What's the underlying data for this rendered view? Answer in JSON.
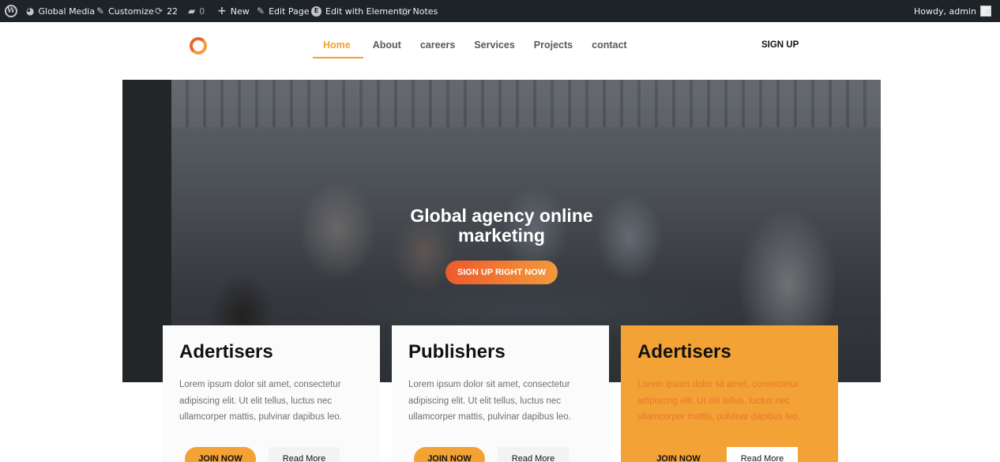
{
  "admin_bar": {
    "site_name": "Global Media",
    "customize": "Customize",
    "updates_count": "22",
    "comments_count": "0",
    "new": "New",
    "edit_page": "Edit Page",
    "elementor": "Edit with Elementor",
    "notes": "Notes",
    "greeting": "Howdy, admin"
  },
  "nav": {
    "items": [
      "Home",
      "About",
      "careers",
      "Services",
      "Projects",
      "contact"
    ],
    "active": "Home",
    "signup": "SIGN UP"
  },
  "hero": {
    "title": "Global agency online marketing",
    "button": "SIGN UP RIGHT NOW"
  },
  "cards": [
    {
      "title": "Adertisers",
      "text": "Lorem ipsum dolor sit amet, consectetur adipiscing elit. Ut elit tellus, luctus nec ullamcorper mattis, pulvinar dapibus leo.",
      "join": "JOIN NOW",
      "more": "Read More"
    },
    {
      "title": "Publishers",
      "text": "Lorem ipsum dolor sit amet, consectetur adipiscing elit. Ut elit tellus, luctus nec ullamcorper mattis, pulvinar dapibus leo.",
      "join": "JOIN NOW",
      "more": "Read More"
    },
    {
      "title": "Adertisers",
      "text": "Lorem ipsum dolor sit amet, consectetur adipiscing elit. Ut elit tellus, luctus nec ullamcorper mattis, pulvinar dapibus leo.",
      "join": "JOIN NOW",
      "more": "Read More"
    }
  ],
  "colors": {
    "accent": "#f3a235",
    "admin_bar": "#1d2327",
    "hero_button_start": "#ee5a2a",
    "hero_button_end": "#f29a3b"
  }
}
